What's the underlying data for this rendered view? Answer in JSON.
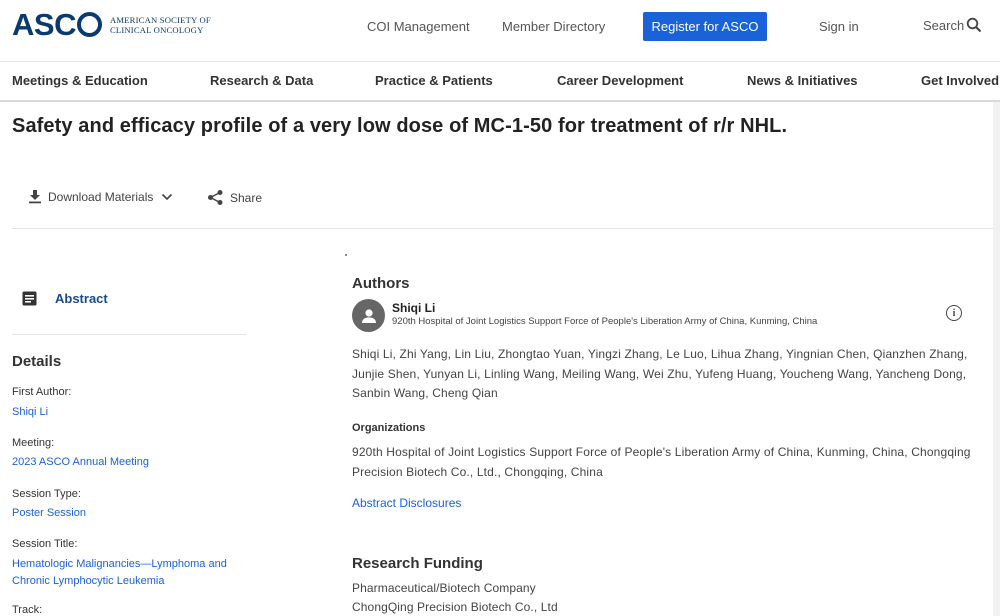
{
  "header": {
    "logo_word_left": "ASC",
    "logo_line1": "AMERICAN SOCIETY OF",
    "logo_line2": "CLINICAL ONCOLOGY",
    "coi": "COI Management",
    "member_directory": "Member Directory",
    "register": "Register for ASCO",
    "sign_in": "Sign in",
    "search": "Search",
    "accent_color": "#1a62d8",
    "brand_color": "#0b3a6e"
  },
  "nav": [
    "Meetings & Education",
    "Research & Data",
    "Practice & Patients",
    "Career Development",
    "News & Initiatives",
    "Get Involved"
  ],
  "title": "Safety and efficacy profile of a very low dose of MC-1-50 for treatment of r/r NHL.",
  "actions": {
    "download": "Download Materials",
    "share": "Share"
  },
  "sidebar": {
    "abstract": "Abstract",
    "details_heading": "Details",
    "details": [
      {
        "label": "First Author:",
        "value": "Shiqi Li"
      },
      {
        "label": "Meeting:",
        "value": "2023 ASCO Annual Meeting"
      },
      {
        "label": "Session Type:",
        "value": "Poster Session"
      },
      {
        "label": "Session Title:",
        "value": "Hematologic Malignancies—Lymphoma and Chronic Lymphocytic Leukemia"
      },
      {
        "label": "Track:",
        "value": ""
      }
    ]
  },
  "main": {
    "authors_heading": "Authors",
    "first_author_name": "Shiqi Li",
    "first_author_affiliation": "920th Hospital of Joint Logistics Support Force of People's Liberation Army of China, Kunming, China",
    "authors_list": "Shiqi Li, Zhi Yang, Lin Liu, Zhongtao Yuan, Yingzi Zhang, Le Luo, Lihua Zhang, Yingnian Chen, Qianzhen Zhang, Junjie Shen, Yunyan Li, Linling Wang, Meiling Wang, Wei Zhu, Yufeng Huang, Youcheng Wang, Yancheng Dong, Sanbin Wang, Cheng Qian",
    "organizations_heading": "Organizations",
    "organizations": "920th Hospital of Joint Logistics Support Force of People's Liberation Army of China, Kunming, China, Chongqing Precision Biotech Co., Ltd., Chongqing, China",
    "disclosures": "Abstract Disclosures",
    "funding_heading": "Research Funding",
    "funding_lines": [
      "Pharmaceutical/Biotech Company",
      "ChongQing Precision Biotech Co., Ltd"
    ]
  }
}
